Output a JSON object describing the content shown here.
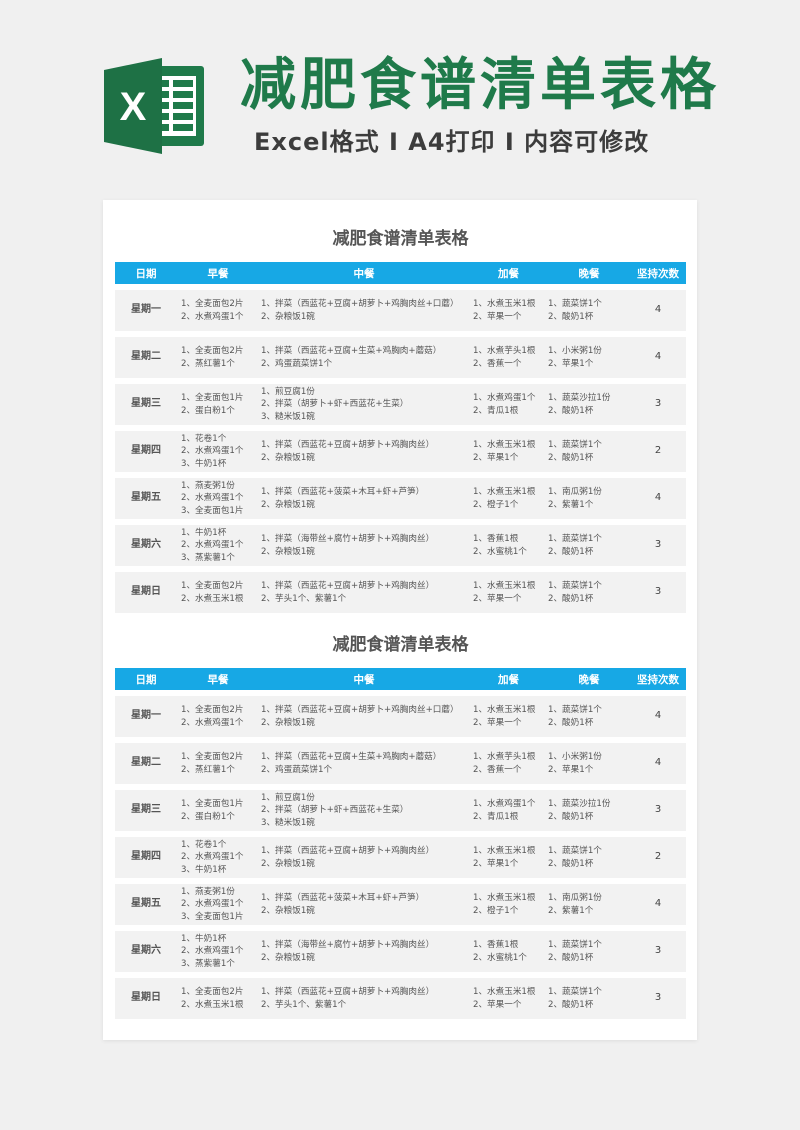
{
  "header": {
    "title": "减肥食谱清单表格",
    "subtitle": "Excel格式 Ⅰ A4打印 Ⅰ 内容可修改",
    "logo_letter": "X",
    "brand_color": "#1f7a4a"
  },
  "table_title": "减肥食谱清单表格",
  "columns": [
    "日期",
    "早餐",
    "中餐",
    "加餐",
    "晚餐",
    "坚持次数"
  ],
  "rows": [
    {
      "day": "星期一",
      "breakfast": [
        "1、全麦面包2片",
        "2、水煮鸡蛋1个"
      ],
      "lunch": [
        "1、拌菜（西蓝花+豆腐+胡萝卜+鸡胸肉丝+口蘑）",
        "2、杂粮饭1碗"
      ],
      "snack": [
        "1、水煮玉米1根",
        "2、苹果一个"
      ],
      "dinner": [
        "1、蔬菜饼1个",
        "2、酸奶1杯"
      ],
      "count": "4"
    },
    {
      "day": "星期二",
      "breakfast": [
        "1、全麦面包2片",
        "2、蒸红薯1个"
      ],
      "lunch": [
        "1、拌菜（西蓝花+豆腐+生菜+鸡胸肉+蘑菇）",
        "2、鸡蛋蔬菜饼1个"
      ],
      "snack": [
        "1、水煮芋头1根",
        "2、香蕉一个"
      ],
      "dinner": [
        "1、小米粥1份",
        "2、苹果1个"
      ],
      "count": "4"
    },
    {
      "day": "星期三",
      "breakfast": [
        "1、全麦面包1片",
        "2、蛋白粉1个"
      ],
      "lunch": [
        "1、煎豆腐1份",
        "2、拌菜（胡萝卜+虾+西蓝花+生菜）",
        "3、糙米饭1碗"
      ],
      "snack": [
        "1、水煮鸡蛋1个",
        "2、青瓜1根"
      ],
      "dinner": [
        "1、蔬菜沙拉1份",
        "2、酸奶1杯"
      ],
      "count": "3"
    },
    {
      "day": "星期四",
      "breakfast": [
        "1、花卷1个",
        "2、水煮鸡蛋1个",
        "3、牛奶1杯"
      ],
      "lunch": [
        "1、拌菜（西蓝花+豆腐+胡萝卜+鸡胸肉丝）",
        "2、杂粮饭1碗"
      ],
      "snack": [
        "1、水煮玉米1根",
        "2、苹果1个"
      ],
      "dinner": [
        "1、蔬菜饼1个",
        "2、酸奶1杯"
      ],
      "count": "2"
    },
    {
      "day": "星期五",
      "breakfast": [
        "1、燕麦粥1份",
        "2、水煮鸡蛋1个",
        "3、全麦面包1片"
      ],
      "lunch": [
        "1、拌菜（西蓝花+菠菜+木耳+虾+芦笋）",
        "2、杂粮饭1碗"
      ],
      "snack": [
        "1、水煮玉米1根",
        "2、橙子1个"
      ],
      "dinner": [
        "1、南瓜粥1份",
        "2、紫薯1个"
      ],
      "count": "4"
    },
    {
      "day": "星期六",
      "breakfast": [
        "1、牛奶1杯",
        "2、水煮鸡蛋1个",
        "3、蒸紫薯1个"
      ],
      "lunch": [
        "1、拌菜（海带丝+腐竹+胡萝卜+鸡胸肉丝）",
        "2、杂粮饭1碗"
      ],
      "snack": [
        "1、香蕉1根",
        "2、水蜜桃1个"
      ],
      "dinner": [
        "1、蔬菜饼1个",
        "2、酸奶1杯"
      ],
      "count": "3"
    },
    {
      "day": "星期日",
      "breakfast": [
        "1、全麦面包2片",
        "2、水煮玉米1根"
      ],
      "lunch": [
        "1、拌菜（西蓝花+豆腐+胡萝卜+鸡胸肉丝）",
        "2、芋头1个、紫薯1个"
      ],
      "snack": [
        "1、水煮玉米1根",
        "2、苹果一个"
      ],
      "dinner": [
        "1、蔬菜饼1个",
        "2、酸奶1杯"
      ],
      "count": "3"
    }
  ]
}
